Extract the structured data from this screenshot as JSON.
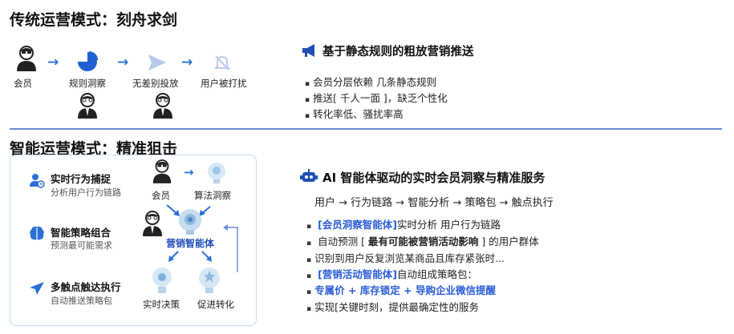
{
  "top": {
    "title": "传统运营模式：刻舟求剑",
    "flow": [
      "会员",
      "规则洞察",
      "无差别投放",
      "用户被打扰"
    ],
    "heading": "基于静态规则的粗放营销推送",
    "bullets": [
      "会员分层依赖 几条静态规则",
      "推送[ 千人一面 ]，缺乏个性化",
      "转化率低、骚扰率高"
    ]
  },
  "bottom": {
    "title": "智能运营模式：精准狙击",
    "features": [
      {
        "title": "实时行为捕捉",
        "sub": "分析用户行为链路"
      },
      {
        "title": "智能策略组合",
        "sub": "预测最可能需求"
      },
      {
        "title": "多触点触达执行",
        "sub": "自动推送策略包"
      }
    ],
    "diagram": {
      "member": "会员",
      "algo": "算法洞察",
      "agent": "营销智能体",
      "decision": "实时决策",
      "convert": "促进转化"
    },
    "heading": "AI 智能体驱动的实时会员洞察与精准服务",
    "chain": "用户 → 行为链路 → 智能分析 → 策略包 → 触点执行",
    "bullets": {
      "b1_tag": "[会员洞察智能体]",
      "b1_text": "实时分析 用户行为链路",
      "b2_pre": "自动预测 [ ",
      "b2_bold": "最有可能被营销活动影响",
      "b2_post": " ] 的用户群体",
      "b3": "识别到用户反复浏览某商品且库存紧张时...",
      "b4_tag": "[营销活动智能体]",
      "b4_text": "自动组成策略包：",
      "b5": "专属价 + 库存锁定 + 导购企业微信提醒",
      "b6": "实现[关键时刻，提供最确定性的服务"
    }
  },
  "colors": {
    "accent": "#2a6fd6",
    "divider": "#6a8cd8",
    "highlight": "#2a5bd7"
  }
}
